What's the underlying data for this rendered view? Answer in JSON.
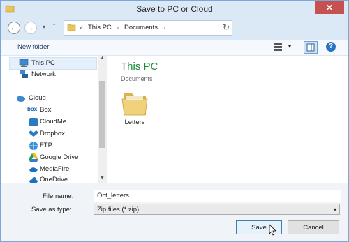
{
  "window": {
    "title": "Save to PC or Cloud",
    "close_symbol": "✕"
  },
  "nav": {
    "back_symbol": "←",
    "forward_symbol": "→",
    "recent_symbol": "▾",
    "up_symbol": "↑",
    "breadcrumb_prefix": "«",
    "breadcrumbs": [
      "This PC",
      "Documents"
    ],
    "separator": "›",
    "refresh_symbol": "↻"
  },
  "toolbar": {
    "new_folder_label": "New folder",
    "help_symbol": "?"
  },
  "sidebar": {
    "items": [
      {
        "label": "This PC",
        "icon": "computer-icon",
        "selected": true
      },
      {
        "label": "Network",
        "icon": "network-icon"
      },
      {
        "label": "Cloud",
        "icon": "cloud-icon"
      },
      {
        "label": "Box",
        "icon": "box-icon"
      },
      {
        "label": "CloudMe",
        "icon": "cloudme-icon"
      },
      {
        "label": "Dropbox",
        "icon": "dropbox-icon"
      },
      {
        "label": "FTP",
        "icon": "ftp-icon"
      },
      {
        "label": "Google Drive",
        "icon": "google-drive-icon"
      },
      {
        "label": "MediaFire",
        "icon": "mediafire-icon"
      },
      {
        "label": "OneDrive",
        "icon": "onedrive-icon"
      }
    ]
  },
  "content": {
    "location_title": "This PC",
    "location_subtitle": "Documents",
    "items": [
      {
        "label": "Letters",
        "icon": "folder-icon"
      }
    ]
  },
  "form": {
    "filename_label": "File name:",
    "filename_value": "Oct_letters",
    "filetype_label": "Save as type:",
    "filetype_value": "Zip files (*.zip)",
    "save_label": "Save",
    "cancel_label": "Cancel"
  },
  "colors": {
    "accent": "#1e8b3e",
    "selection": "#e6f0fb",
    "primary_button_border": "#3c7fb1"
  }
}
